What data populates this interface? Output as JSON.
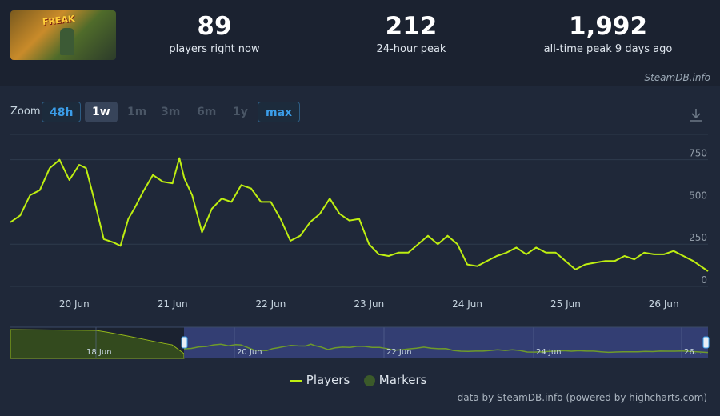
{
  "stats": [
    {
      "value": "89",
      "label": "players right now"
    },
    {
      "value": "212",
      "label": "24-hour peak"
    },
    {
      "value": "1,992",
      "label": "all-time peak 9 days ago"
    }
  ],
  "credit_top": "SteamDB.info",
  "zoom": {
    "label": "Zoom",
    "buttons": [
      "48h",
      "1w",
      "1m",
      "3m",
      "6m",
      "1y",
      "max"
    ],
    "selected": "1w"
  },
  "navigator_labels": [
    "18 Jun",
    "20 Jun",
    "22 Jun",
    "24 Jun",
    "26..."
  ],
  "legend": {
    "players": "Players",
    "markers": "Markers"
  },
  "credit_bottom": "data by SteamDB.info (powered by highcharts.com)",
  "colors": {
    "players_line": "#beee11",
    "markers": "#3b5a2a",
    "nav_fill": "#354077"
  },
  "chart_data": {
    "type": "line",
    "title": "",
    "xlabel": "",
    "ylabel": "",
    "ylim": [
      0,
      900
    ],
    "y_ticks": [
      0,
      250,
      500,
      750
    ],
    "x_tick_labels": [
      "20 Jun",
      "21 Jun",
      "22 Jun",
      "23 Jun",
      "24 Jun",
      "25 Jun",
      "26 Jun"
    ],
    "x_range_days": [
      19.35,
      26.45
    ],
    "series": [
      {
        "name": "Players",
        "x": [
          19.35,
          19.45,
          19.55,
          19.65,
          19.75,
          19.85,
          19.95,
          20.05,
          20.12,
          20.2,
          20.3,
          20.4,
          20.47,
          20.55,
          20.62,
          20.7,
          20.8,
          20.9,
          21.0,
          21.07,
          21.12,
          21.2,
          21.3,
          21.4,
          21.5,
          21.6,
          21.7,
          21.8,
          21.9,
          22.0,
          22.1,
          22.2,
          22.3,
          22.4,
          22.5,
          22.6,
          22.7,
          22.8,
          22.9,
          23.0,
          23.1,
          23.2,
          23.3,
          23.4,
          23.5,
          23.6,
          23.7,
          23.8,
          23.9,
          24.0,
          24.1,
          24.2,
          24.3,
          24.4,
          24.5,
          24.6,
          24.7,
          24.8,
          24.9,
          25.0,
          25.1,
          25.2,
          25.3,
          25.4,
          25.5,
          25.6,
          25.7,
          25.8,
          25.9,
          26.0,
          26.1,
          26.2,
          26.3,
          26.45
        ],
        "values": [
          380,
          420,
          540,
          570,
          700,
          750,
          630,
          720,
          700,
          520,
          280,
          260,
          240,
          400,
          470,
          560,
          660,
          620,
          610,
          760,
          640,
          540,
          320,
          460,
          520,
          500,
          600,
          580,
          500,
          500,
          400,
          270,
          300,
          380,
          430,
          520,
          430,
          390,
          400,
          250,
          190,
          180,
          200,
          200,
          250,
          300,
          250,
          300,
          250,
          130,
          120,
          150,
          180,
          200,
          230,
          190,
          230,
          200,
          200,
          150,
          100,
          130,
          140,
          150,
          150,
          180,
          160,
          200,
          190,
          190,
          210,
          180,
          150,
          90
        ]
      }
    ]
  }
}
